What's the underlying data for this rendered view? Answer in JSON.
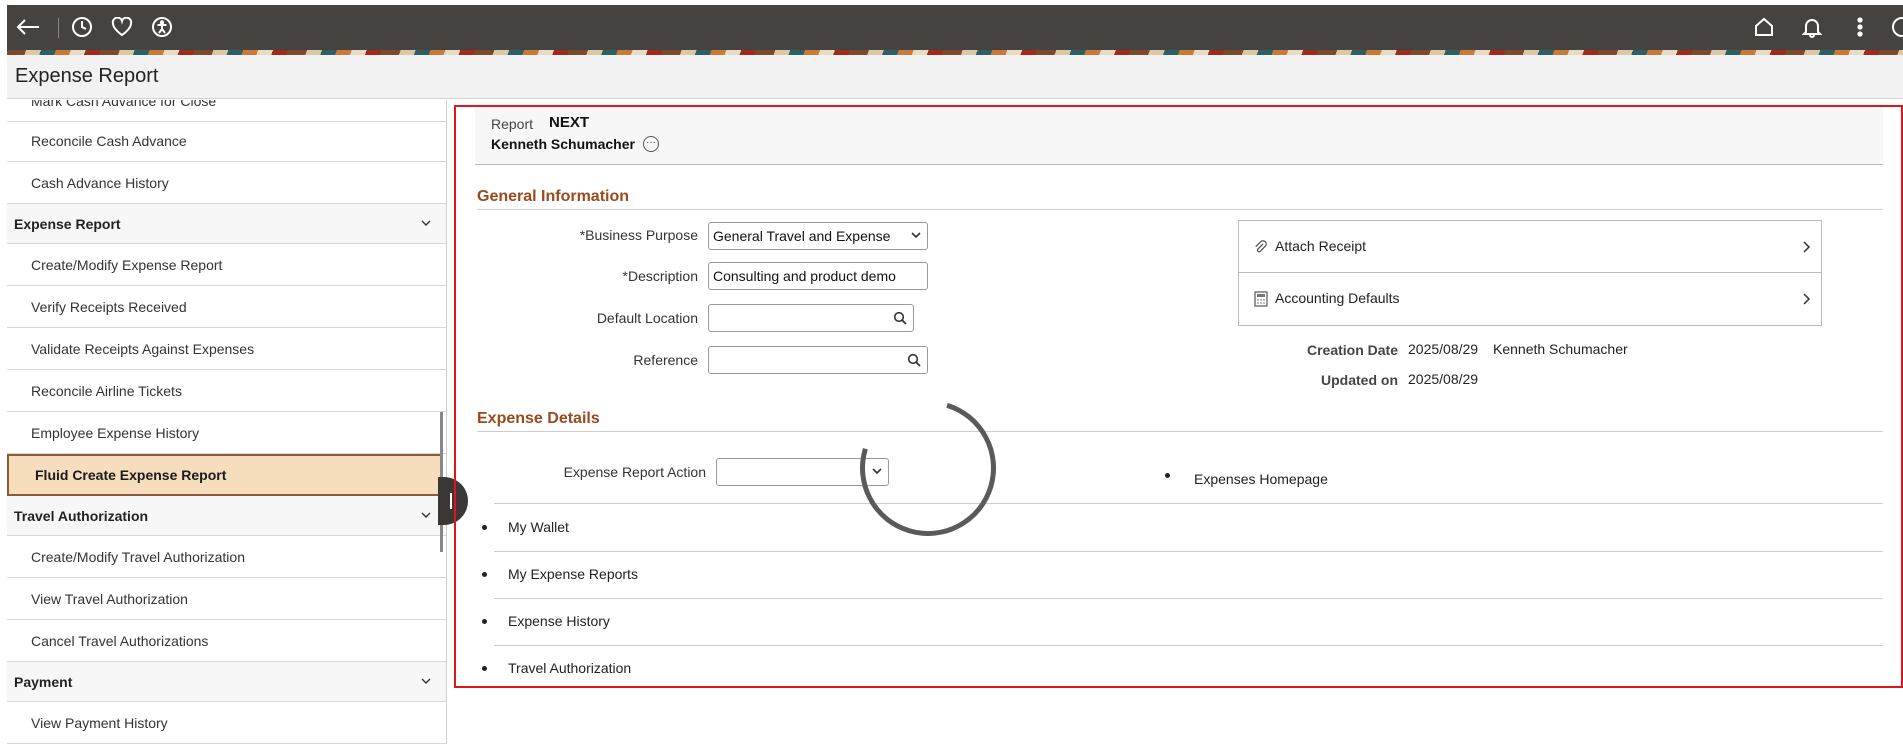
{
  "topbar": {
    "icons": [
      "back-arrow-icon",
      "history-icon",
      "favorites-heart-icon",
      "accessibility-icon",
      "home-icon",
      "notification-bell-icon",
      "more-vertical-icon"
    ]
  },
  "page": {
    "title": "Expense Report"
  },
  "leftnav": {
    "items": [
      {
        "type": "item",
        "label": "Mark Cash Advance for Close"
      },
      {
        "type": "item",
        "label": "Reconcile Cash Advance"
      },
      {
        "type": "item",
        "label": "Cash Advance History"
      },
      {
        "type": "group",
        "label": "Expense Report"
      },
      {
        "type": "item",
        "label": "Create/Modify Expense Report"
      },
      {
        "type": "item",
        "label": "Verify Receipts Received"
      },
      {
        "type": "item",
        "label": "Validate Receipts Against Expenses"
      },
      {
        "type": "item",
        "label": "Reconcile Airline Tickets"
      },
      {
        "type": "item",
        "label": "Employee Expense History"
      },
      {
        "type": "item",
        "label": "Fluid Create Expense Report",
        "active": true
      },
      {
        "type": "group",
        "label": "Travel Authorization"
      },
      {
        "type": "item",
        "label": "Create/Modify Travel Authorization"
      },
      {
        "type": "item",
        "label": "View Travel Authorization"
      },
      {
        "type": "item",
        "label": "Cancel Travel Authorizations"
      },
      {
        "type": "group",
        "label": "Payment"
      },
      {
        "type": "item",
        "label": "View Payment History"
      }
    ]
  },
  "report_header": {
    "report_label": "Report",
    "report_value": "NEXT",
    "employee_name": "Kenneth Schumacher",
    "more_glyph": "···"
  },
  "general_info": {
    "section_title": "General Information",
    "business_purpose_label": "*Business Purpose",
    "business_purpose_value": "General Travel and Expense",
    "description_label": "*Description",
    "description_value": "Consulting and product demo",
    "default_location_label": "Default Location",
    "default_location_value": "",
    "reference_label": "Reference",
    "reference_value": "",
    "attach_receipt_label": "Attach Receipt",
    "accounting_defaults_label": "Accounting Defaults",
    "creation_date_label": "Creation Date",
    "creation_date_value": "2025/08/29",
    "creation_user": "Kenneth Schumacher",
    "updated_on_label": "Updated on",
    "updated_on_value": "2025/08/29"
  },
  "expense_details": {
    "section_title": "Expense Details",
    "action_label": "Expense Report Action",
    "action_value": "",
    "homepage_link": "Expenses Homepage",
    "links": [
      "My Wallet",
      "My Expense Reports",
      "Expense History",
      "Travel Authorization"
    ]
  }
}
